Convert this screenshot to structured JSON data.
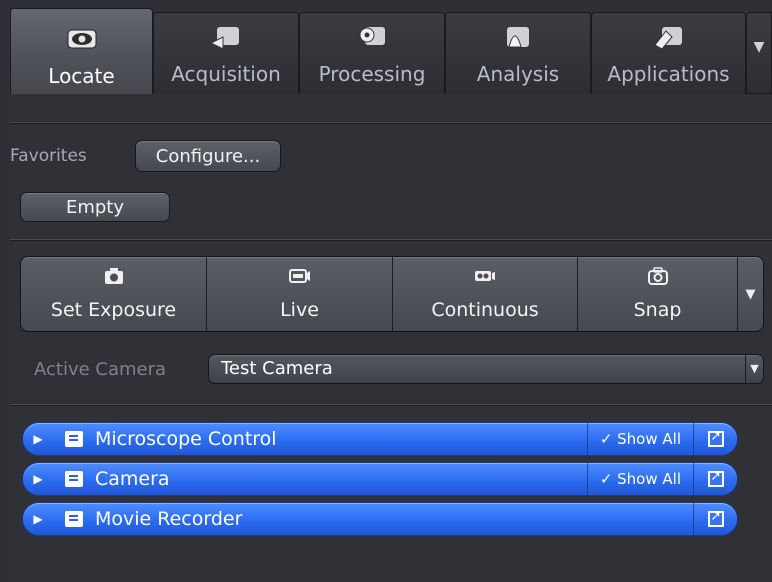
{
  "tabs": [
    {
      "label": "Locate",
      "icon": "eye-icon",
      "active": true
    },
    {
      "label": "Acquisition",
      "icon": "acquire-icon",
      "active": false
    },
    {
      "label": "Processing",
      "icon": "gear-icon",
      "active": false
    },
    {
      "label": "Analysis",
      "icon": "histogram-icon",
      "active": false
    },
    {
      "label": "Applications",
      "icon": "applications-icon",
      "active": false
    }
  ],
  "favorites": {
    "label": "Favorites",
    "configure_label": "Configure...",
    "empty_label": "Empty"
  },
  "acquisition_buttons": [
    {
      "label": "Set Exposure",
      "icon": "camera-icon"
    },
    {
      "label": "Live",
      "icon": "live-icon"
    },
    {
      "label": "Continuous",
      "icon": "continuous-icon"
    },
    {
      "label": "Snap",
      "icon": "snap-camera-icon"
    }
  ],
  "active_camera": {
    "label": "Active Camera",
    "value": "Test Camera"
  },
  "tools": [
    {
      "label": "Microscope Control",
      "show_all": "✓ Show All",
      "expanded": true
    },
    {
      "label": "Camera",
      "show_all": "✓ Show All",
      "expanded": false
    },
    {
      "label": "Movie Recorder",
      "show_all": "",
      "expanded": false
    }
  ],
  "colors": {
    "accent": "#2c6cf0",
    "background": "#2e3035"
  }
}
